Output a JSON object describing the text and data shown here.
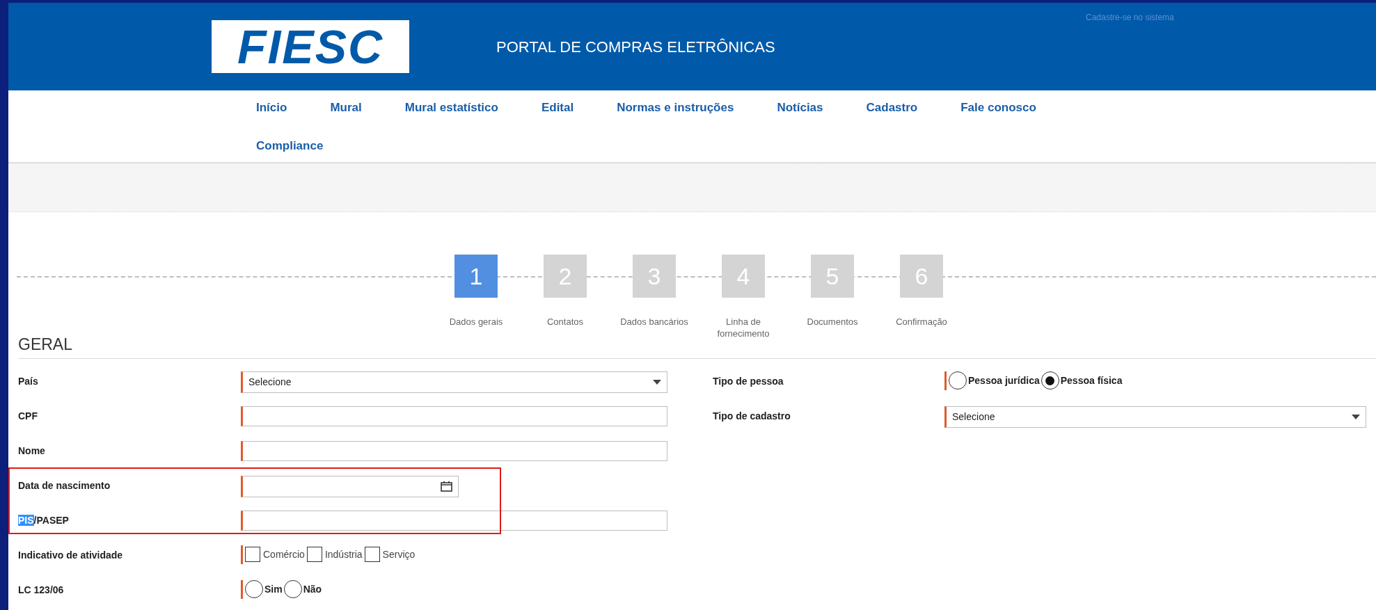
{
  "header": {
    "logo": "FIESC",
    "title": "PORTAL DE COMPRAS ELETRÔNICAS",
    "register_link": "Cadastre-se no sistema"
  },
  "nav": [
    {
      "label": "Início"
    },
    {
      "label": "Mural"
    },
    {
      "label": "Mural estatístico"
    },
    {
      "label": "Edital"
    },
    {
      "label": "Normas e instruções"
    },
    {
      "label": "Notícias"
    },
    {
      "label": "Cadastro"
    },
    {
      "label": "Fale conosco"
    },
    {
      "label": "Compliance"
    }
  ],
  "steps": [
    {
      "number": "1",
      "label": "Dados gerais",
      "selected": true
    },
    {
      "number": "2",
      "label": "Contatos",
      "selected": false
    },
    {
      "number": "3",
      "label": "Dados bancários",
      "selected": false
    },
    {
      "number": "4",
      "label": "Linha de fornecimento",
      "selected": false
    },
    {
      "number": "5",
      "label": "Documentos",
      "selected": false
    },
    {
      "number": "6",
      "label": "Confirmação",
      "selected": false
    }
  ],
  "section_title": "GERAL",
  "left_fields": [
    {
      "kind": "select",
      "label": "País",
      "value": "Selecione"
    },
    {
      "kind": "text",
      "label": "CPF"
    },
    {
      "kind": "text",
      "label": "Nome"
    },
    {
      "kind": "date",
      "label": "Data de nascimento",
      "annotated": true
    },
    {
      "kind": "text",
      "selected_text": "PIS",
      "label": "/PASEP",
      "annotated": true
    },
    {
      "kind": "checkboxes",
      "label": "Indicativo de atividade",
      "options": [
        {
          "label": "Comércio",
          "checked": false
        },
        {
          "label": "Indústria",
          "checked": false
        },
        {
          "label": "Serviço",
          "checked": false
        }
      ]
    },
    {
      "kind": "radios",
      "label": "LC 123/06",
      "options": [
        {
          "label": "Sim",
          "selected": false
        },
        {
          "label": "Não",
          "selected": false
        }
      ]
    }
  ],
  "right_fields": [
    {
      "kind": "radios",
      "label": "Tipo de pessoa",
      "options": [
        {
          "label": "Pessoa jurídica",
          "selected": false
        },
        {
          "label": "Pessoa física",
          "selected": true
        }
      ]
    },
    {
      "kind": "select",
      "label": "Tipo de cadastro",
      "value": "Selecione"
    }
  ]
}
